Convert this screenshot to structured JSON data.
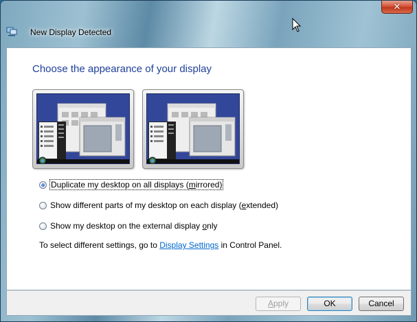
{
  "window": {
    "title": "New Display Detected",
    "close_glyph": "✕"
  },
  "heading": "Choose the appearance of your display",
  "previews": [
    {
      "name": "mirrored-preview"
    },
    {
      "name": "extended-preview"
    }
  ],
  "options": [
    {
      "label_pre": "Duplicate my desktop on all displays (",
      "label_ul": "m",
      "label_post": "irrored)",
      "checked": true
    },
    {
      "label_pre": "Show different parts of my desktop on each display (",
      "label_ul": "e",
      "label_post": "xtended)",
      "checked": false
    },
    {
      "label_pre": "Show my desktop on the external display ",
      "label_ul": "o",
      "label_post": "nly",
      "checked": false
    }
  ],
  "settings": {
    "prefix": "To select different settings, go to ",
    "link": "Display Settings",
    "suffix": " in Control Panel."
  },
  "buttons": {
    "apply_ul": "A",
    "apply_rest": "pply",
    "ok": "OK",
    "cancel": "Cancel"
  },
  "colors": {
    "heading": "#1e3f9a",
    "link": "#0066cc",
    "desktop": "#2f428e",
    "close": "#c1381b"
  }
}
